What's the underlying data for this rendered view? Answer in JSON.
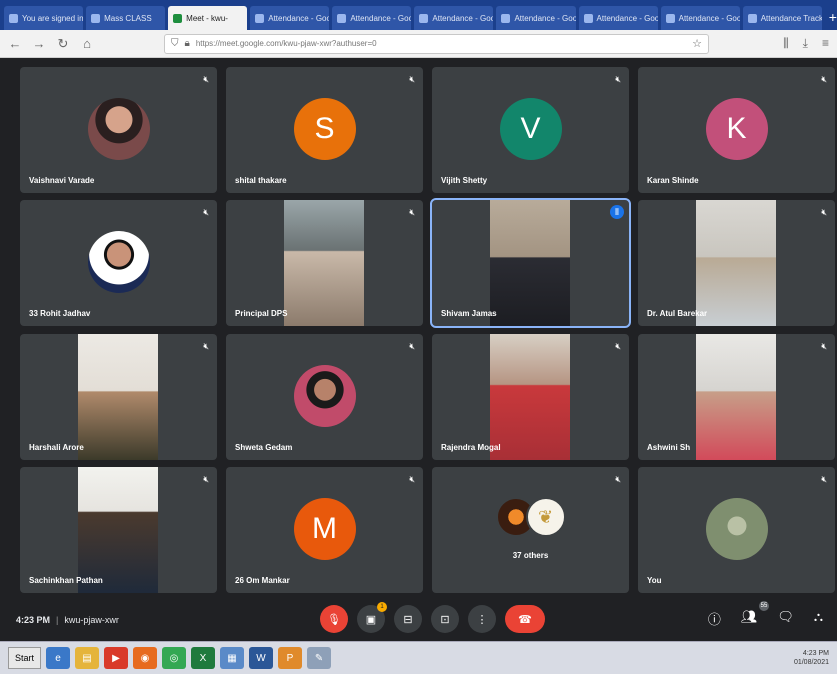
{
  "browser": {
    "tabs": [
      {
        "label": "You are signed in",
        "active": false
      },
      {
        "label": "Mass CLASS",
        "active": false
      },
      {
        "label": "Meet - kwu-",
        "active": true
      },
      {
        "label": "Attendance - Goo",
        "active": false
      },
      {
        "label": "Attendance - Goo",
        "active": false
      },
      {
        "label": "Attendance - Goo",
        "active": false
      },
      {
        "label": "Attendance - Goo",
        "active": false
      },
      {
        "label": "Attendance - Goo",
        "active": false
      },
      {
        "label": "Attendance - Goo",
        "active": false
      },
      {
        "label": "Attendance Track",
        "active": false
      }
    ],
    "url": "https://meet.google.com/kwu-pjaw-xwr?authuser=0"
  },
  "participants": [
    {
      "name": "Vaishnavi Varade",
      "type": "photo",
      "avatar_style": "photo-circle"
    },
    {
      "name": "shital thakare",
      "type": "letter",
      "initial": "S",
      "color": "#e8710a"
    },
    {
      "name": "Vijith Shetty",
      "type": "letter",
      "initial": "V",
      "color": "#12866b"
    },
    {
      "name": "Karan Shinde",
      "type": "letter",
      "initial": "K",
      "color": "#c2507a"
    },
    {
      "name": "33 Rohit Jadhav",
      "type": "photo",
      "avatar_style": "boy"
    },
    {
      "name": "Principal DPS",
      "type": "camera"
    },
    {
      "name": "Shivam Jamas",
      "type": "camera",
      "speaking": true
    },
    {
      "name": "Dr. Atul Barekar",
      "type": "camera"
    },
    {
      "name": "Harshali Arore",
      "type": "camera"
    },
    {
      "name": "Shweta Gedam",
      "type": "photo",
      "avatar_style": "woman2"
    },
    {
      "name": "Rajendra Mogal",
      "type": "camera"
    },
    {
      "name": "Ashwini Sh",
      "type": "camera"
    },
    {
      "name": "Sachinkhan Pathan",
      "type": "camera"
    },
    {
      "name": "26 Om Mankar",
      "type": "letter",
      "initial": "M",
      "color": "#e8590c"
    },
    {
      "name": "",
      "type": "others",
      "others_label": "37 others"
    },
    {
      "name": "You",
      "type": "photo",
      "avatar_style": "you"
    }
  ],
  "controls": {
    "time": "4:23 PM",
    "meeting_code": "kwu-pjaw-xwr",
    "participant_count": "55",
    "raise_badge": "1"
  },
  "taskbar": {
    "start_label": "Start",
    "tray_time": "4:23 PM",
    "tray_date": "01/08/2021"
  }
}
